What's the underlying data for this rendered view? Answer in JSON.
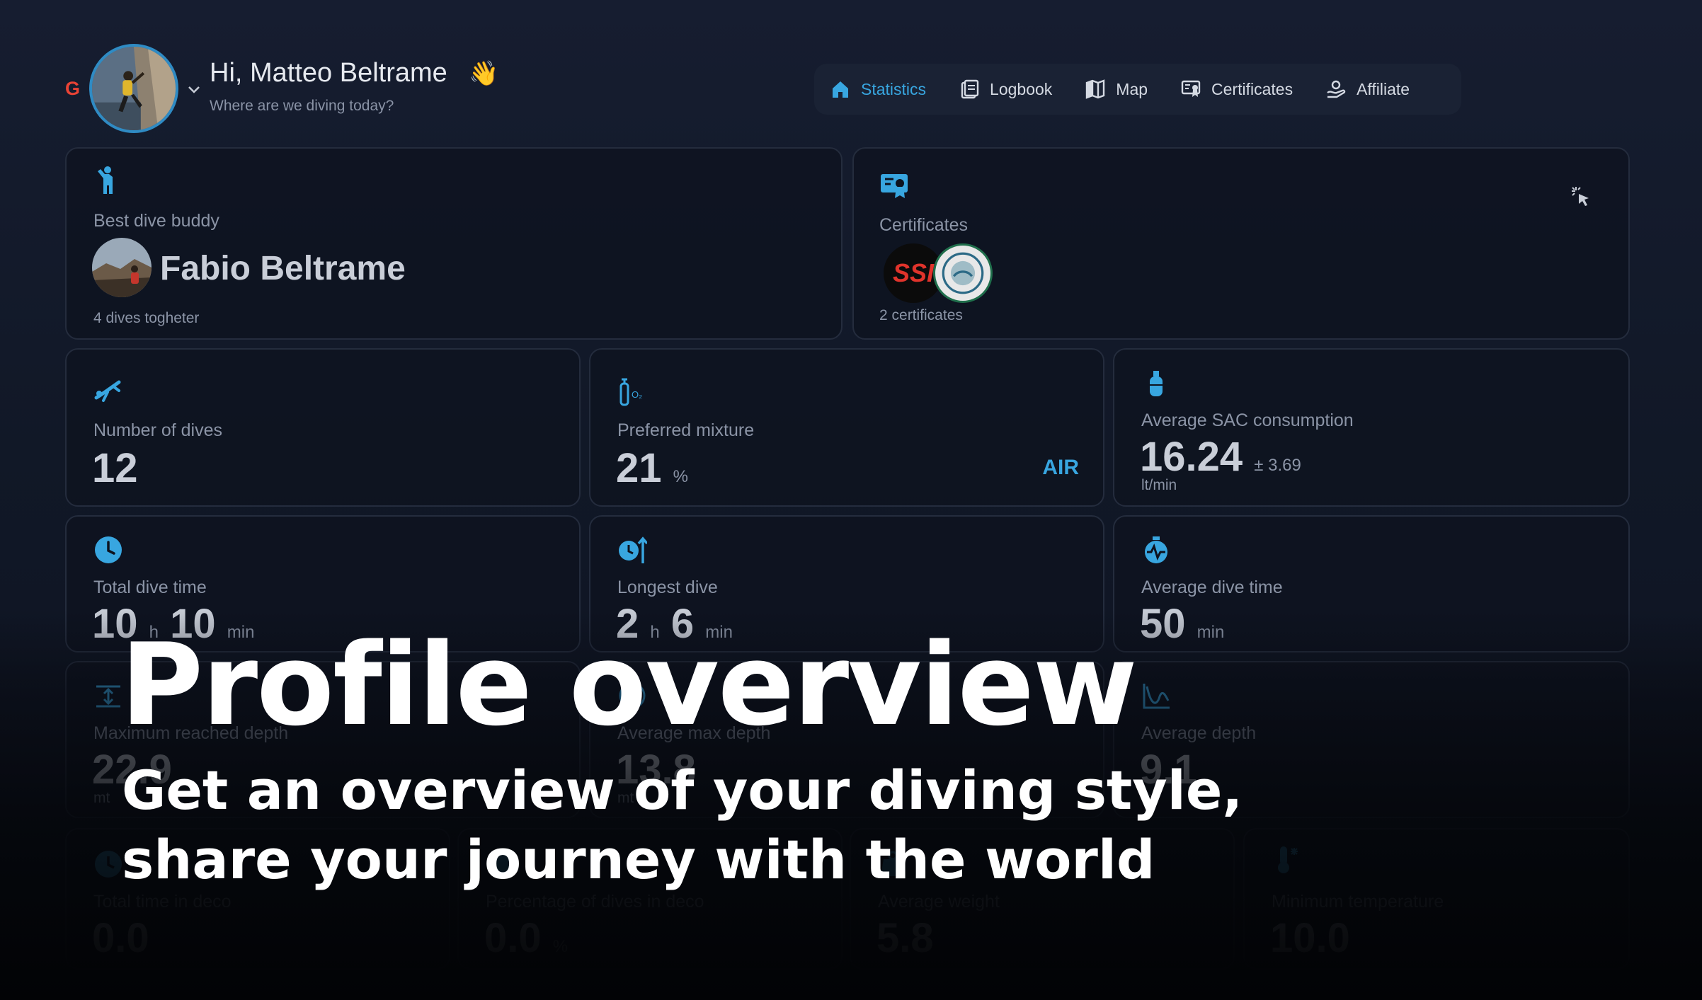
{
  "header": {
    "greeting": "Hi, Matteo Beltrame",
    "wave": "👋",
    "subtitle": "Where are we diving today?",
    "google_mark": "G"
  },
  "nav": {
    "items": [
      {
        "label": "Statistics",
        "icon": "home-icon",
        "active": true
      },
      {
        "label": "Logbook",
        "icon": "logbook-icon",
        "active": false
      },
      {
        "label": "Map",
        "icon": "map-icon",
        "active": false
      },
      {
        "label": "Certificates",
        "icon": "certificate-icon",
        "active": false
      },
      {
        "label": "Affiliate",
        "icon": "affiliate-icon",
        "active": false
      }
    ]
  },
  "buddy": {
    "label": "Best dive buddy",
    "name": "Fabio Beltrame",
    "sub": "4 dives togheter"
  },
  "certificates": {
    "label": "Certificates",
    "badge1": "SSI",
    "sub": "2 certificates"
  },
  "stats": {
    "dives": {
      "label": "Number of dives",
      "value": "12"
    },
    "mixture": {
      "label": "Preferred mixture",
      "value": "21",
      "unit": "%",
      "tag": "AIR"
    },
    "sac": {
      "label": "Average SAC consumption",
      "value": "16.24",
      "dev": "± 3.69",
      "unit": "lt/min"
    },
    "total_time": {
      "label": "Total dive time",
      "h": "10",
      "h_unit": "h",
      "m": "10",
      "m_unit": "min"
    },
    "longest": {
      "label": "Longest dive",
      "h": "2",
      "h_unit": "h",
      "m": "6",
      "m_unit": "min"
    },
    "avg_time": {
      "label": "Average dive time",
      "value": "50",
      "unit": "min"
    },
    "max_depth": {
      "label": "Maximum reached depth",
      "value": "22.9",
      "unit": "mt"
    },
    "avg_max_depth": {
      "label": "Average max depth",
      "value": "13.8",
      "unit": "mt"
    },
    "avg_depth": {
      "label": "Average depth",
      "value": "9.1",
      "unit": "mt"
    },
    "deco_time": {
      "label": "Total time in deco",
      "value": "0.0"
    },
    "deco_pct": {
      "label": "Percentage of dives in deco",
      "value": "0.0",
      "unit": "%"
    },
    "weight": {
      "label": "Average weight",
      "value": "5.8"
    },
    "min_temp": {
      "label": "Minimum temperature",
      "value": "10.0"
    }
  },
  "overlay": {
    "title": "Profile overview",
    "line1": "Get an overview of your diving style,",
    "line2": "share your journey with the world"
  },
  "colors": {
    "accent": "#38a6e0",
    "background": "#111827",
    "card_border": "#242c3d"
  }
}
